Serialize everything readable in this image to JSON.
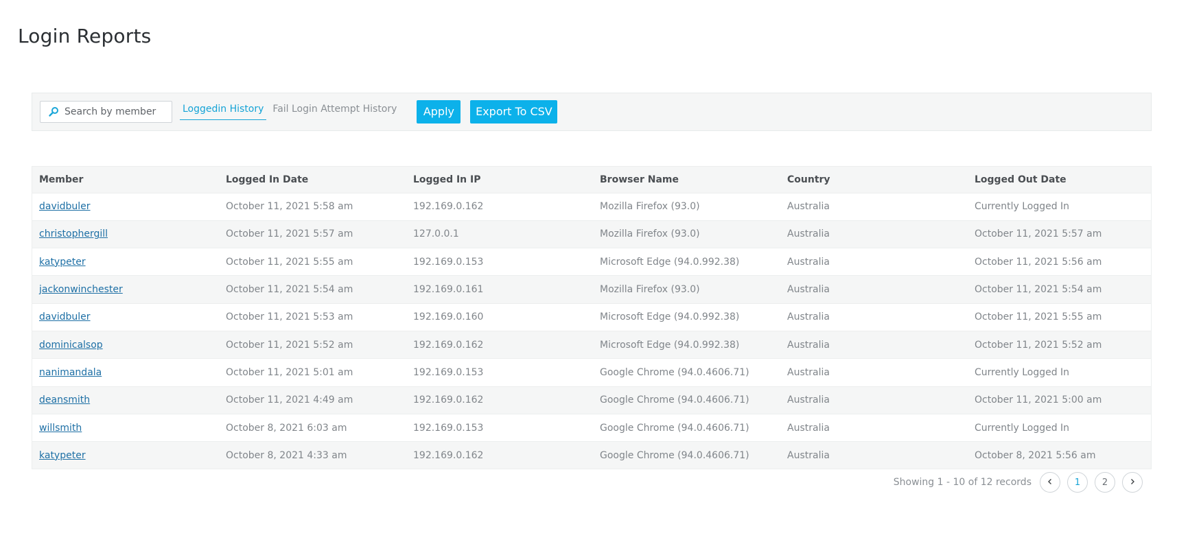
{
  "page": {
    "title": "Login Reports"
  },
  "toolbar": {
    "search_placeholder": "Search by member",
    "search_value": "",
    "tabs": [
      {
        "label": "Loggedin History",
        "active": true
      },
      {
        "label": "Fail Login Attempt History",
        "active": false
      }
    ],
    "apply_label": "Apply",
    "export_label": "Export To CSV"
  },
  "table": {
    "columns": [
      "Member",
      "Logged In Date",
      "Logged In IP",
      "Browser Name",
      "Country",
      "Logged Out Date"
    ],
    "rows": [
      {
        "member": "davidbuler",
        "logged_in_date": "October 11, 2021 5:58 am",
        "ip": "192.169.0.162",
        "browser": "Mozilla Firefox (93.0)",
        "country": "Australia",
        "logged_out_date": "Currently Logged In"
      },
      {
        "member": "christophergill",
        "logged_in_date": "October 11, 2021 5:57 am",
        "ip": "127.0.0.1",
        "browser": "Mozilla Firefox (93.0)",
        "country": "Australia",
        "logged_out_date": "October 11, 2021 5:57 am"
      },
      {
        "member": "katypeter",
        "logged_in_date": "October 11, 2021 5:55 am",
        "ip": "192.169.0.153",
        "browser": "Microsoft Edge (94.0.992.38)",
        "country": "Australia",
        "logged_out_date": "October 11, 2021 5:56 am"
      },
      {
        "member": "jackonwinchester",
        "logged_in_date": "October 11, 2021 5:54 am",
        "ip": "192.169.0.161",
        "browser": "Mozilla Firefox (93.0)",
        "country": "Australia",
        "logged_out_date": "October 11, 2021 5:54 am"
      },
      {
        "member": "davidbuler",
        "logged_in_date": "October 11, 2021 5:53 am",
        "ip": "192.169.0.160",
        "browser": "Microsoft Edge (94.0.992.38)",
        "country": "Australia",
        "logged_out_date": "October 11, 2021 5:55 am"
      },
      {
        "member": "dominicalsop",
        "logged_in_date": "October 11, 2021 5:52 am",
        "ip": "192.169.0.162",
        "browser": "Microsoft Edge (94.0.992.38)",
        "country": "Australia",
        "logged_out_date": "October 11, 2021 5:52 am"
      },
      {
        "member": "nanimandala",
        "logged_in_date": "October 11, 2021 5:01 am",
        "ip": "192.169.0.153",
        "browser": "Google Chrome (94.0.4606.71)",
        "country": "Australia",
        "logged_out_date": "Currently Logged In"
      },
      {
        "member": "deansmith",
        "logged_in_date": "October 11, 2021 4:49 am",
        "ip": "192.169.0.162",
        "browser": "Google Chrome (94.0.4606.71)",
        "country": "Australia",
        "logged_out_date": "October 11, 2021 5:00 am"
      },
      {
        "member": "willsmith",
        "logged_in_date": "October 8, 2021 6:03 am",
        "ip": "192.169.0.153",
        "browser": "Google Chrome (94.0.4606.71)",
        "country": "Australia",
        "logged_out_date": "Currently Logged In"
      },
      {
        "member": "katypeter",
        "logged_in_date": "October 8, 2021 4:33 am",
        "ip": "192.169.0.162",
        "browser": "Google Chrome (94.0.4606.71)",
        "country": "Australia",
        "logged_out_date": "October 8, 2021 5:56 am"
      }
    ]
  },
  "pagination": {
    "summary": "Showing 1 - 10 of 12 records",
    "pages": [
      "1",
      "2"
    ],
    "current": "1",
    "prev_icon": "chevron-left-icon",
    "next_icon": "chevron-right-icon"
  },
  "colors": {
    "accent": "#0cb1ea",
    "tab_active": "#15a3d6",
    "link": "#1d6fa5"
  }
}
